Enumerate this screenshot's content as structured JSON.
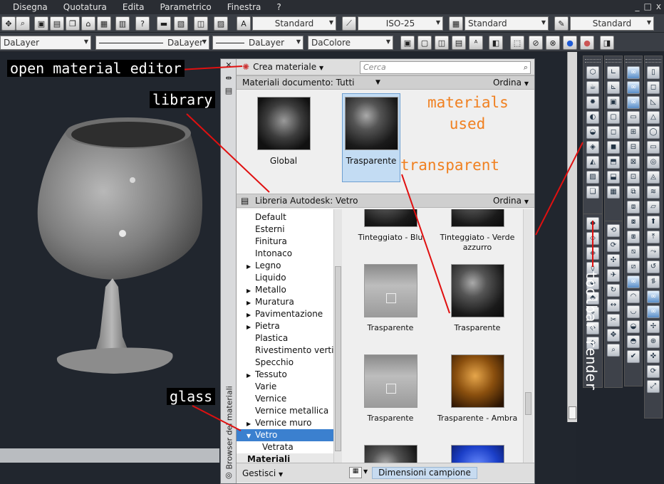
{
  "menu": {
    "items": [
      "Disegna",
      "Quotatura",
      "Edita",
      "Parametrico",
      "Finestra",
      "?"
    ]
  },
  "window_controls": [
    "_",
    "□",
    "x"
  ],
  "toolbar1": {
    "text_style": "Standard",
    "dim_style": "ISO-25",
    "table_style": "Standard",
    "multileader_style": "Standard"
  },
  "toolbar2": {
    "layer_combo": "DaLayer",
    "linetype": "DaLayer",
    "lineweight": "DaLayer",
    "color": "DaColore"
  },
  "palette": {
    "title_vertical": "Browser dei materiali",
    "create_label": "Crea materiale",
    "search_placeholder": "Cerca",
    "doc_header": "Materiali documento: Tutti",
    "sort_label": "Ordina",
    "doc_materials": [
      {
        "label": "Global"
      },
      {
        "label": "Trasparente"
      }
    ],
    "library_header": "Libreria Autodesk: Vetro",
    "tree": [
      {
        "label": "Default",
        "expander": ""
      },
      {
        "label": "Esterni",
        "expander": ""
      },
      {
        "label": "Finitura",
        "expander": ""
      },
      {
        "label": "Intonaco",
        "expander": ""
      },
      {
        "label": "Legno",
        "expander": "▶"
      },
      {
        "label": "Liquido",
        "expander": ""
      },
      {
        "label": "Metallo",
        "expander": "▶"
      },
      {
        "label": "Muratura",
        "expander": "▶"
      },
      {
        "label": "Pavimentazione",
        "expander": "▶"
      },
      {
        "label": "Pietra",
        "expander": "▶"
      },
      {
        "label": "Plastica",
        "expander": ""
      },
      {
        "label": "Rivestimento vertic...",
        "expander": ""
      },
      {
        "label": "Specchio",
        "expander": ""
      },
      {
        "label": "Tessuto",
        "expander": "▶"
      },
      {
        "label": "Varie",
        "expander": ""
      },
      {
        "label": "Vernice",
        "expander": ""
      },
      {
        "label": "Vernice metallica",
        "expander": ""
      },
      {
        "label": "Vernice muro",
        "expander": "▶"
      },
      {
        "label": "Vetro",
        "expander": "▼"
      },
      {
        "label": "Vetrata",
        "expander": ""
      },
      {
        "label": "Materiali",
        "expander": ""
      }
    ],
    "library_items": [
      {
        "label": "Tinteggiato - Blu",
        "swatch": "dark-glass-sphere"
      },
      {
        "label": "Tinteggiato - Verde azzurro",
        "swatch": "dark-glass-sphere"
      },
      {
        "label": "Trasparente",
        "swatch": "glass-box"
      },
      {
        "label": "Trasparente",
        "swatch": "dark-glass-sphere"
      },
      {
        "label": "Trasparente",
        "swatch": "glass-box"
      },
      {
        "label": "Trasparente - Ambra",
        "swatch": "amber-sphere"
      },
      {
        "label": "",
        "swatch": "dark-glass-sphere"
      },
      {
        "label": "",
        "swatch": "blue-sphere"
      }
    ],
    "manage_label": "Gestisci",
    "sample_size_label": "Dimensioni campione"
  },
  "annotations": {
    "open_material_editor": "open material editor",
    "library": "library",
    "glass": "glass",
    "materials_used_1": "materials",
    "materials_used_2": "used",
    "transparent": "transparent",
    "toolbar_render": "toolbar render"
  },
  "colors": {
    "annotation_arrow": "#e01010",
    "annotation_orange": "#f08020",
    "selection_blue": "#3b80cf"
  }
}
